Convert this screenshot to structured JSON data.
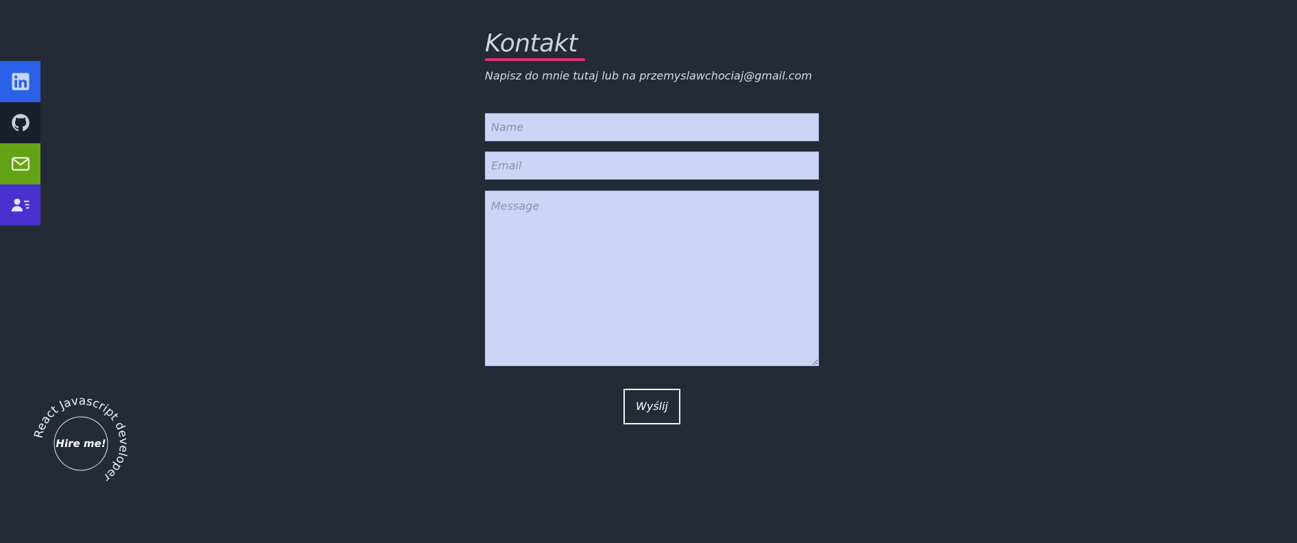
{
  "social": {
    "items": [
      {
        "name": "linkedin",
        "icon": "linkedin-icon",
        "color": "#2a61e8"
      },
      {
        "name": "github",
        "icon": "github-icon",
        "color": "#1a1f2c"
      },
      {
        "name": "email",
        "icon": "mail-icon",
        "color": "#64a315"
      },
      {
        "name": "cv",
        "icon": "contact-card-icon",
        "color": "#4a30ce"
      }
    ]
  },
  "contact": {
    "title": "Kontakt",
    "subtitle": "Napisz do mnie tutaj lub na przemyslawchociaj@gmail.com",
    "accent_color": "#e0316c",
    "form": {
      "name_placeholder": "Name",
      "email_placeholder": "Email",
      "message_placeholder": "Message",
      "submit_label": "Wyślij"
    }
  },
  "badge": {
    "label": "Hire me!",
    "ring_text": "React Javascript developer"
  }
}
